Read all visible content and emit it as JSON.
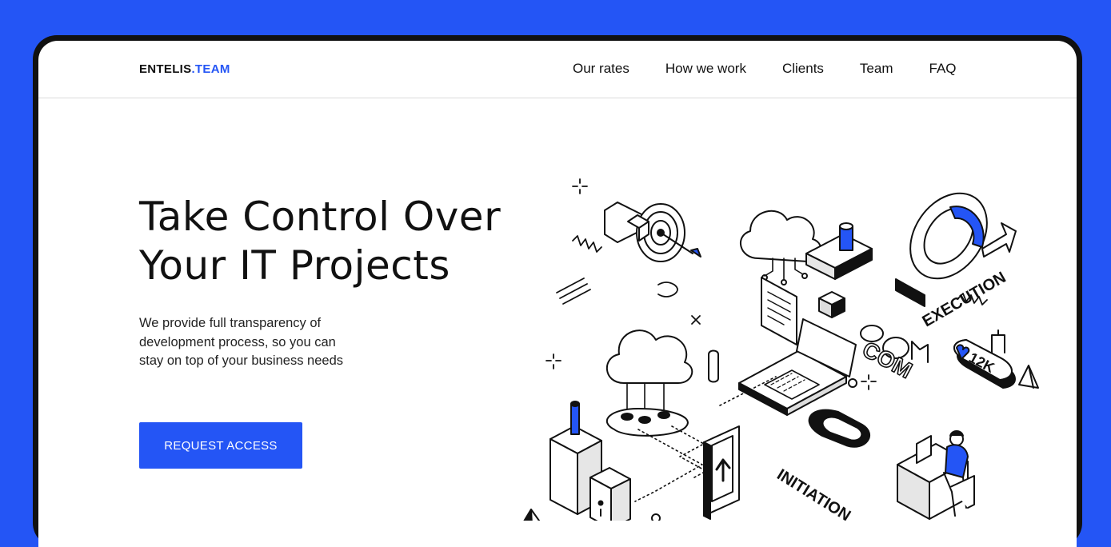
{
  "brand": {
    "name": "ENTELIS",
    "tld": ".TEAM"
  },
  "nav": {
    "items": [
      {
        "label": "Our rates"
      },
      {
        "label": "How we work"
      },
      {
        "label": "Clients"
      },
      {
        "label": "Team"
      },
      {
        "label": "FAQ"
      }
    ]
  },
  "hero": {
    "title_line1": "Take Control Over",
    "title_line2": "Your IT Projects",
    "description": "We provide full transparency of development process, so you can stay on top of your business needs",
    "cta_label": "REQUEST ACCESS"
  },
  "illustration": {
    "execution_label": "EXECUTION",
    "initiation_label": "INITIATION",
    "com_label": "COM",
    "likes_label": "12K"
  },
  "colors": {
    "background": "#2455f5",
    "accent": "#2455f5",
    "text": "#111111"
  }
}
